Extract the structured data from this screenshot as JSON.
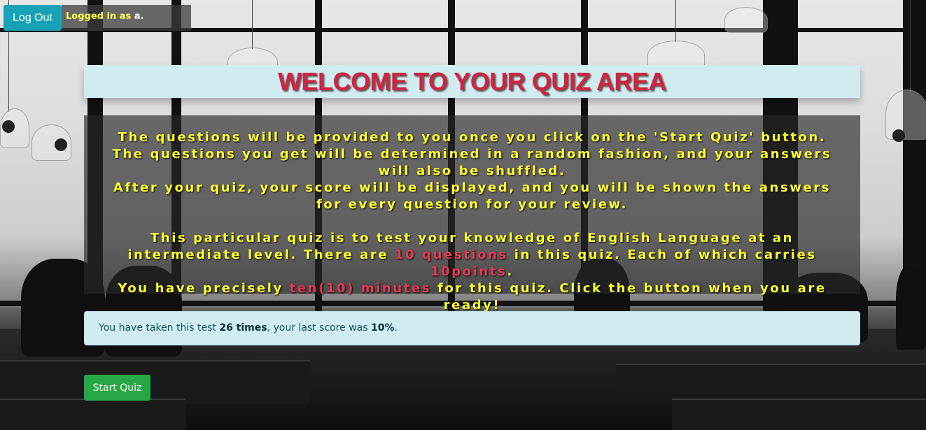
{
  "topbar": {
    "logout_label": "Log Out",
    "logged_prefix": "Logged in as",
    "username": "a."
  },
  "title": "WELCOME TO YOUR QUIZ AREA",
  "info": {
    "line1": "The questions will be provided to you once you click on the 'Start Quiz' button.",
    "line2": "The questions you get will be determined in a random fashion, and your answers will also be shuffled.",
    "line3": "After your quiz, your score will be displayed, and you will be shown the answers for every question for your review.",
    "p2_a": "This particular quiz is to test your knowledge of English Language at an intermediate level. There are ",
    "p2_questions": "10 questions",
    "p2_b": " in this quiz. Each of which carries ",
    "p2_points": "10points",
    "p2_c": ".",
    "p3_a": "You have precisely ",
    "p3_time": "ten(10) minutes",
    "p3_b": " for this quiz. Click the button when you are ready!"
  },
  "alert": {
    "prefix": "You have taken this test ",
    "times": "26 times",
    "middle": ", your last score was ",
    "score": "10%",
    "suffix": "."
  },
  "start_label": "Start Quiz",
  "colors": {
    "title_red": "#d0243f",
    "info_yellow": "#ffff33",
    "highlight_red": "#e8394f",
    "logout_teal": "#17a2b8",
    "start_green": "#28a745",
    "alert_bg": "#d1ecf1"
  }
}
